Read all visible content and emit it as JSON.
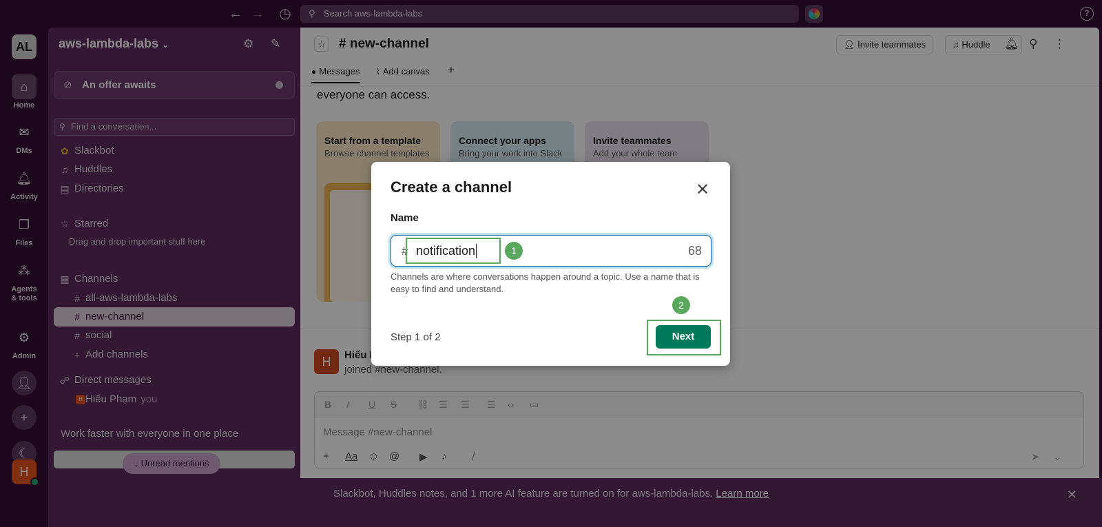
{
  "topbar": {
    "search_placeholder": "Search aws-lambda-labs",
    "back_icon": "arrow-left-icon",
    "forward_icon": "arrow-right-icon",
    "history_icon": "clock-icon",
    "help_label": "?"
  },
  "rail": {
    "workspace_initials": "AL",
    "items": [
      {
        "label": "Home",
        "icon": "home-icon"
      },
      {
        "label": "DMs",
        "icon": "dms-icon"
      },
      {
        "label": "Activity",
        "icon": "bell-icon"
      },
      {
        "label": "Files",
        "icon": "files-icon"
      },
      {
        "label": "Agents & tools",
        "icon": "agents-icon"
      },
      {
        "label": "Admin",
        "icon": "gear-icon"
      }
    ],
    "user_initial": "H"
  },
  "sidebar": {
    "workspace_name": "aws-lambda-labs",
    "offer_label": "An offer awaits",
    "find_placeholder": "Find a conversation...",
    "shortcuts": [
      "Slackbot",
      "Huddles",
      "Directories"
    ],
    "starred_label": "Starred",
    "starred_hint": "Drag and drop important stuff here",
    "channels_label": "Channels",
    "channels": [
      "all-aws-lambda-labs",
      "new-channel",
      "social"
    ],
    "add_channels": "Add channels",
    "dm_label": "Direct messages",
    "dm_user": "Hiếu Phạm",
    "dm_you": "you",
    "promo_text": "Work faster with everyone in one place",
    "unread_mentions": "↓ Unread mentions"
  },
  "main": {
    "channel_title": "# new-channel",
    "invite_button": "Invite teammates",
    "huddle_button": "Huddle",
    "tabs": [
      "Messages",
      "Add canvas"
    ],
    "intro_text": "everyone can access.",
    "cards": [
      {
        "title": "Start from a template",
        "desc": "Browse channel templates"
      },
      {
        "title": "Connect your apps",
        "desc": "Bring your work into Slack"
      },
      {
        "title": "Invite teammates",
        "desc": "Add your whole team"
      }
    ],
    "message": {
      "avatar": "H",
      "name": "Hiếu I",
      "text": "joined #new-channel."
    },
    "composer_placeholder": "Message #new-channel"
  },
  "banner": {
    "text": "Slackbot, Huddles notes, and 1 more AI feature are turned on for aws-lambda-labs.",
    "link": "Learn more"
  },
  "modal": {
    "title": "Create a channel",
    "name_label": "Name",
    "hash": "#",
    "name_value": "notification",
    "char_count": "68",
    "help_text": "Channels are where conversations happen around a topic. Use a name that is easy to find and understand.",
    "step_text": "Step 1 of 2",
    "next_button": "Next"
  },
  "annotations": {
    "badge_1": "1",
    "badge_2": "2",
    "color": "#5aa85e"
  }
}
